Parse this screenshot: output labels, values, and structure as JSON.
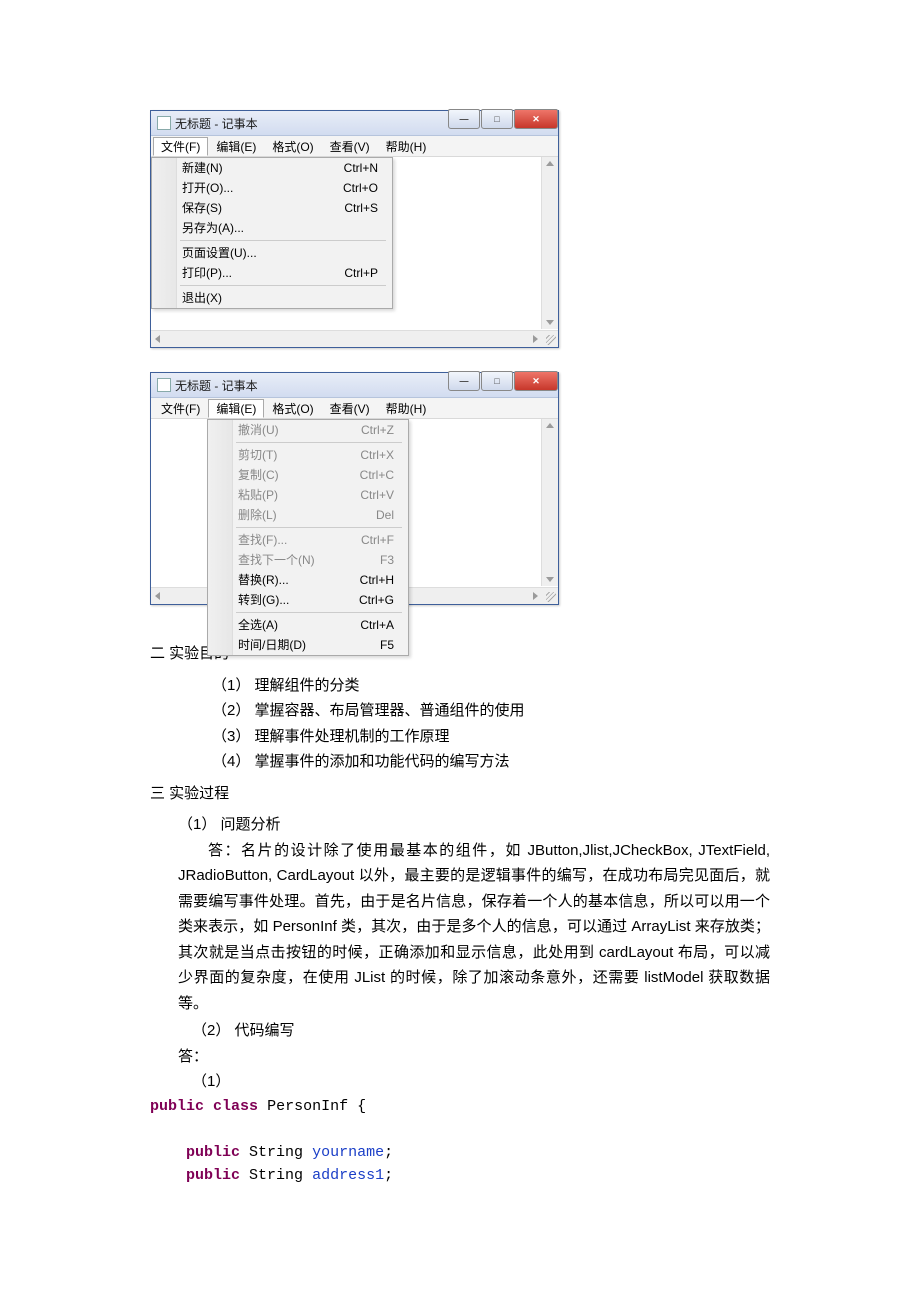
{
  "windows": [
    {
      "title": "无标题 - 记事本",
      "menus": [
        "文件(F)",
        "编辑(E)",
        "格式(O)",
        "查看(V)",
        "帮助(H)"
      ],
      "selectedMenuIndex": 0,
      "dropdownLeft": 0,
      "sections": [
        [
          {
            "label": "新建(N)",
            "shortcut": "Ctrl+N"
          },
          {
            "label": "打开(O)...",
            "shortcut": "Ctrl+O"
          },
          {
            "label": "保存(S)",
            "shortcut": "Ctrl+S"
          },
          {
            "label": "另存为(A)...",
            "shortcut": ""
          }
        ],
        [
          {
            "label": "页面设置(U)...",
            "shortcut": ""
          },
          {
            "label": "打印(P)...",
            "shortcut": "Ctrl+P"
          }
        ],
        [
          {
            "label": "退出(X)",
            "shortcut": ""
          }
        ]
      ],
      "clientClass": "",
      "hscroll": true
    },
    {
      "title": "无标题 - 记事本",
      "menus": [
        "文件(F)",
        "编辑(E)",
        "格式(O)",
        "查看(V)",
        "帮助(H)"
      ],
      "selectedMenuIndex": 1,
      "dropdownLeft": 56,
      "sections": [
        [
          {
            "label": "撤消(U)",
            "shortcut": "Ctrl+Z",
            "disabled": true
          }
        ],
        [
          {
            "label": "剪切(T)",
            "shortcut": "Ctrl+X",
            "disabled": true
          },
          {
            "label": "复制(C)",
            "shortcut": "Ctrl+C",
            "disabled": true
          },
          {
            "label": "粘贴(P)",
            "shortcut": "Ctrl+V",
            "disabled": true
          },
          {
            "label": "删除(L)",
            "shortcut": "Del",
            "disabled": true
          }
        ],
        [
          {
            "label": "查找(F)...",
            "shortcut": "Ctrl+F",
            "disabled": true
          },
          {
            "label": "查找下一个(N)",
            "shortcut": "F3",
            "disabled": true
          },
          {
            "label": "替换(R)...",
            "shortcut": "Ctrl+H"
          },
          {
            "label": "转到(G)...",
            "shortcut": "Ctrl+G"
          }
        ],
        [
          {
            "label": "全选(A)",
            "shortcut": "Ctrl+A"
          },
          {
            "label": "时间/日期(D)",
            "shortcut": "F5"
          }
        ]
      ],
      "clientClass": "small",
      "hscroll": true
    }
  ],
  "buttons": {
    "min": "—",
    "max": "□",
    "close": "✕"
  },
  "doc": {
    "sec2_heading": "二 实验目的",
    "sec2_items": [
      "理解组件的分类",
      "掌握容器、布局管理器、普通组件的使用",
      "理解事件处理机制的工作原理",
      "掌握事件的添加和功能代码的编写方法"
    ],
    "sec3_heading": "三 实验过程",
    "sec3_1_label": "（1）   问题分析",
    "sec3_1_answer": "答：名片的设计除了使用最基本的组件，如 JButton,Jlist,JCheckBox, JTextField, JRadioButton, CardLayout 以外，最主要的是逻辑事件的编写，在成功布局完见面后，就需要编写事件处理。首先，由于是名片信息，保存着一个人的基本信息，所以可以用一个类来表示，如 PersonInf 类，其次，由于是多个人的信息，可以通过 ArrayList 来存放类；其次就是当点击按钮的时候，正确添加和显示信息，此处用到 cardLayout 布局，可以减少界面的复杂度，在使用 JList 的时候，除了加滚动条意外，还需要 listModel 获取数据等。",
    "sec3_2_label": "（2）   代码编写",
    "sec3_2_answer_label": "答：",
    "code_ref": "（1）",
    "code": {
      "kw_public": "public",
      "kw_class": "class",
      "class_name": "PersonInf",
      "brace_open": "{",
      "type_string": "String",
      "field1": "yourname",
      "field2": "address1",
      "semi": ";"
    }
  }
}
